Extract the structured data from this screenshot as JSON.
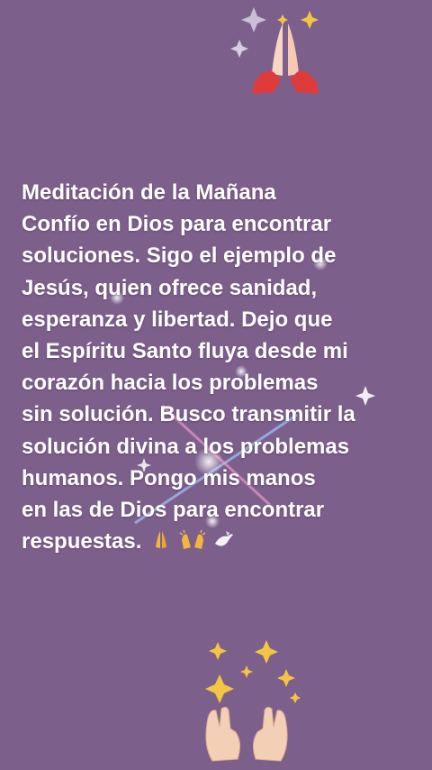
{
  "post": {
    "title": "Meditación de la Mañana",
    "lines": [
      "Confío en Dios para encontrar",
      "soluciones. Sigo el ejemplo de",
      "Jesús, quien ofrece sanidad,",
      "esperanza y libertad. Dejo que",
      "el Espíritu Santo fluya desde mi",
      "corazón hacia los problemas",
      "sin solución. Busco transmitir la",
      "solución divina a los problemas",
      "humanos. Pongo mis manos",
      "en las de Dios para encontrar",
      "respuestas."
    ]
  },
  "icons": [
    "praying-hands-icon",
    "raised-hands-icon",
    "dove-icon",
    "sparkles-icon",
    "open-hands-icon"
  ],
  "colors": {
    "background": "#7d5f8c",
    "text": "#ffffff",
    "sparkle_gold": "#f4c542"
  }
}
